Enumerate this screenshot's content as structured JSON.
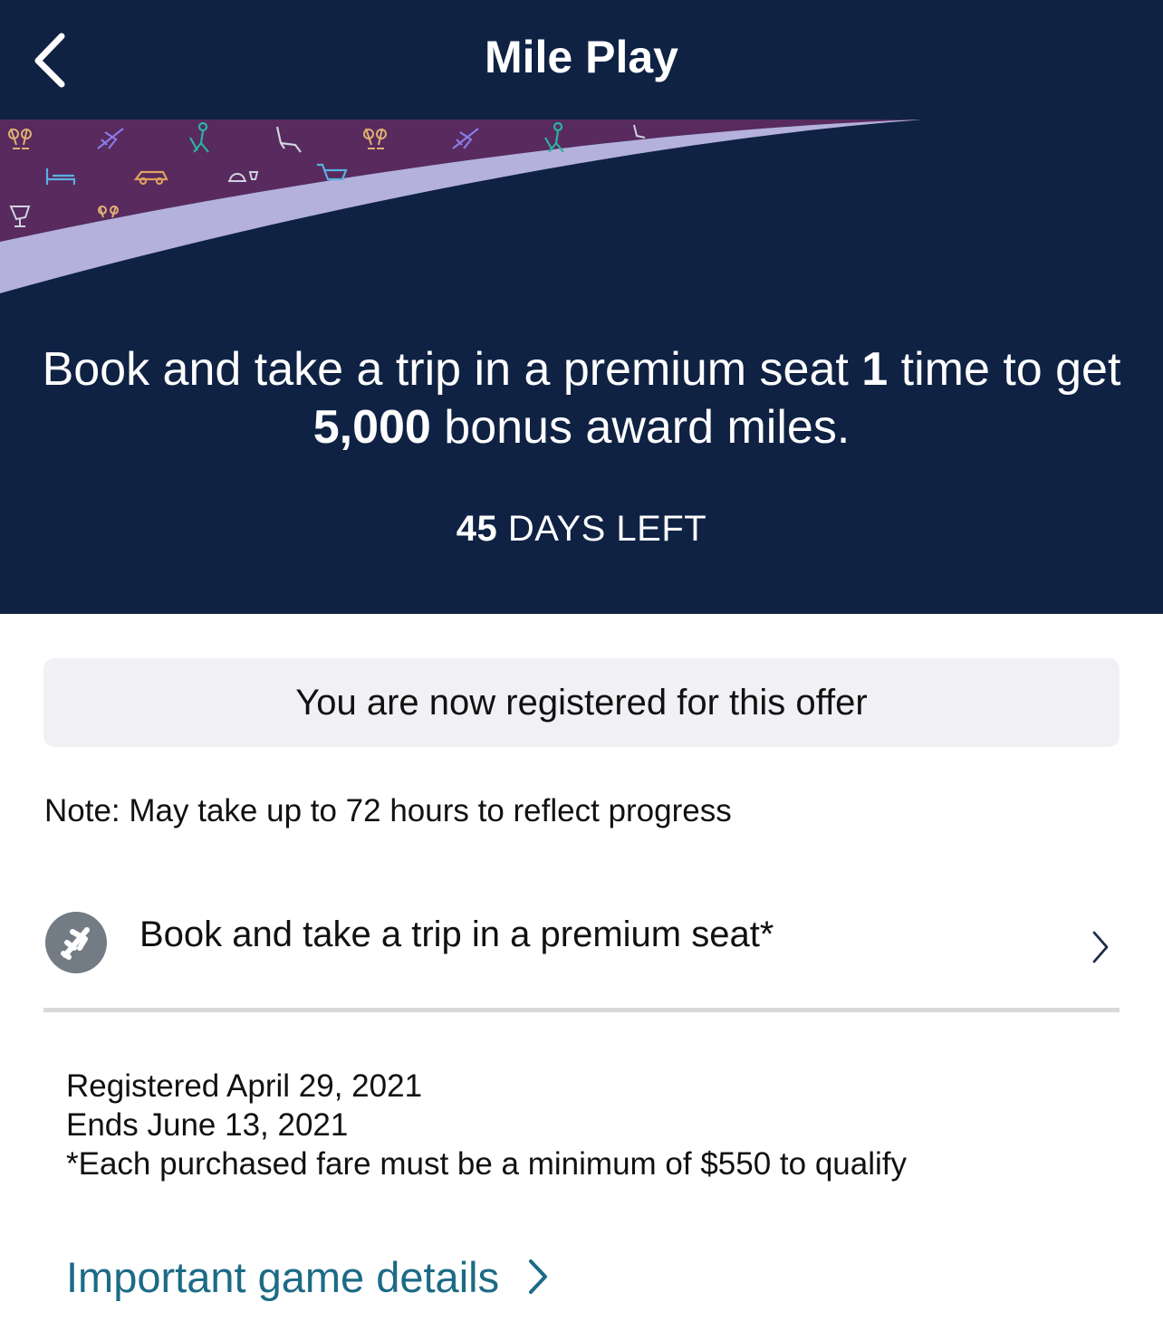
{
  "colors": {
    "navy": "#0f2244",
    "banner_purple": "#582a5e",
    "swoosh": "#b4b1dc",
    "link": "#1c6b86",
    "icon_circle": "#737c85"
  },
  "navbar": {
    "title": "Mile Play",
    "back_icon": "chevron-left-icon"
  },
  "hero": {
    "headline_part1": "Book and take a trip in a premium seat ",
    "headline_count": "1",
    "headline_part2": " time to get ",
    "headline_miles": "5,000",
    "headline_part3": " bonus award miles.",
    "days_number": "45",
    "days_label": " DAYS LEFT",
    "banner_icons": [
      "champagne-icon",
      "airplane-icon",
      "traveler-icon",
      "seat-icon",
      "bed-icon",
      "car-icon",
      "dining-icon",
      "cart-icon",
      "wine-icon"
    ]
  },
  "registration": {
    "status": "You are now registered for this offer"
  },
  "note": "Note: May take up to 72 hours to reflect progress",
  "task": {
    "icon": "airplane-icon",
    "label": "Book and take a trip in a premium seat*"
  },
  "details": {
    "registered": "Registered April 29, 2021",
    "ends": "Ends June 13, 2021",
    "footnote": "*Each purchased fare must be a minimum of $550 to qualify"
  },
  "link": {
    "label": "Important game details"
  }
}
